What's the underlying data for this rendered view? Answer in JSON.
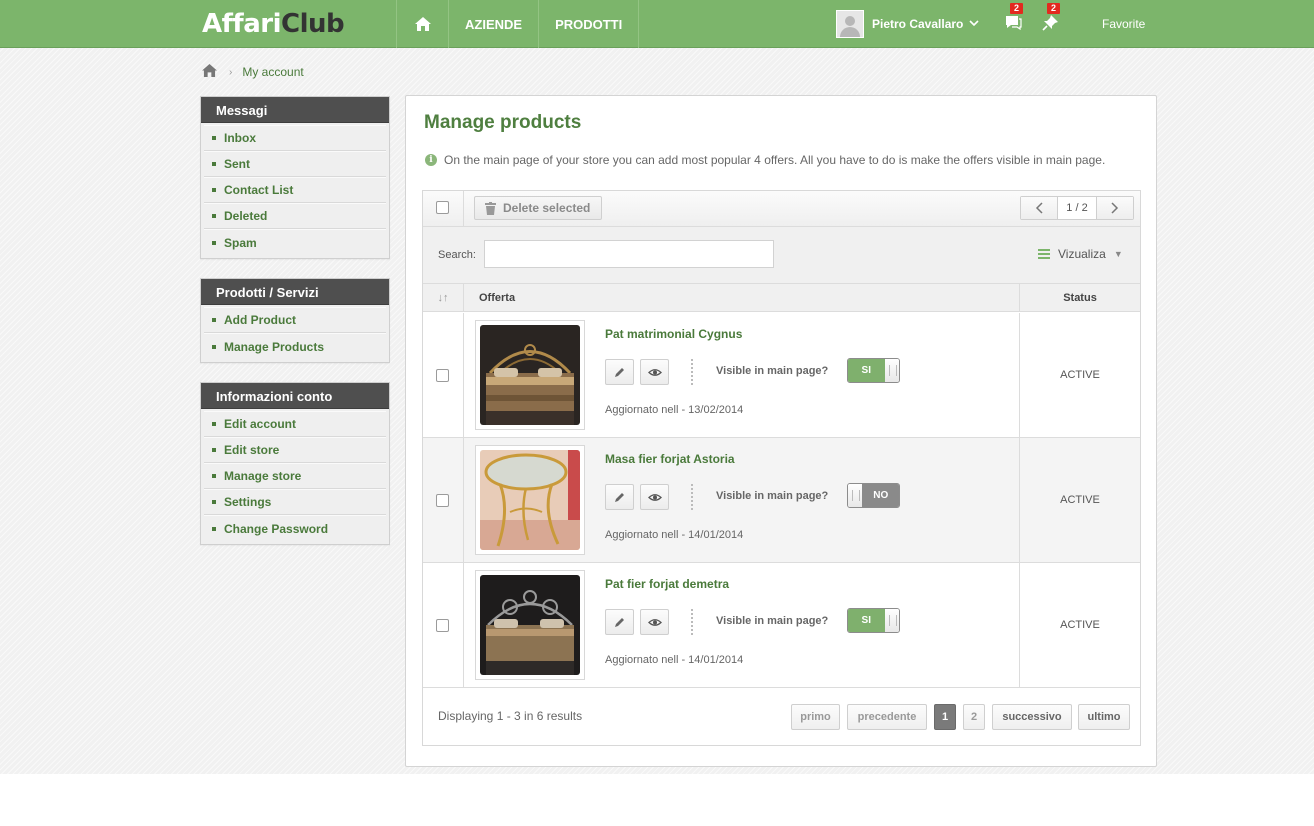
{
  "brand": {
    "logo_part1": "Affari",
    "logo_part2": "Club"
  },
  "nav": {
    "home_icon": "home-icon",
    "items": [
      {
        "label": "AZIENDE"
      },
      {
        "label": "PRODOTTI"
      }
    ]
  },
  "user": {
    "name": "Pietro Cavallaro",
    "messages_badge": "2",
    "notifications_badge": "2",
    "favorite_label": "Favorite"
  },
  "breadcrumb": {
    "current": "My account"
  },
  "sidebar": {
    "sections": [
      {
        "title": "Messagi",
        "items": [
          "Inbox",
          "Sent",
          "Contact List",
          "Deleted",
          "Spam"
        ]
      },
      {
        "title": "Prodotti / Servizi",
        "items": [
          "Add Product",
          "Manage Products"
        ]
      },
      {
        "title": "Informazioni conto",
        "items": [
          "Edit account",
          "Edit store",
          "Manage store",
          "Settings",
          "Change Password"
        ]
      }
    ]
  },
  "main": {
    "title": "Manage products",
    "info": "On the main page of your store you can add most popular 4 offers. All you have to do is make the offers visible in main page.",
    "toolbar": {
      "delete_label": "Delete selected",
      "page_indicator": "1 / 2"
    },
    "search": {
      "label": "Search:",
      "value": ""
    },
    "view": {
      "label": "Vizualiza"
    },
    "columns": {
      "offer": "Offerta",
      "status": "Status"
    },
    "products": [
      {
        "name": "Pat matrimonial Cygnus",
        "visible_label": "Visible in main page?",
        "visible": "SI",
        "updated": "Aggiornato nell - 13/02/2014",
        "status": "ACTIVE"
      },
      {
        "name": "Masa fier forjat Astoria",
        "visible_label": "Visible in main page?",
        "visible": "NO",
        "updated": "Aggiornato nell - 14/01/2014",
        "status": "ACTIVE"
      },
      {
        "name": "Pat fier forjat demetra",
        "visible_label": "Visible in main page?",
        "visible": "SI",
        "updated": "Aggiornato nell - 14/01/2014",
        "status": "ACTIVE"
      }
    ],
    "footer": {
      "displaying": "Displaying 1 - 3 in 6 results",
      "first": "primo",
      "prev": "precedente",
      "pages": [
        "1",
        "2"
      ],
      "next": "successivo",
      "last": "ultimo"
    }
  },
  "colors": {
    "brand_green": "#7cb56b",
    "link_green": "#4a7a3b",
    "sidebar_header": "#4f4f4f"
  }
}
